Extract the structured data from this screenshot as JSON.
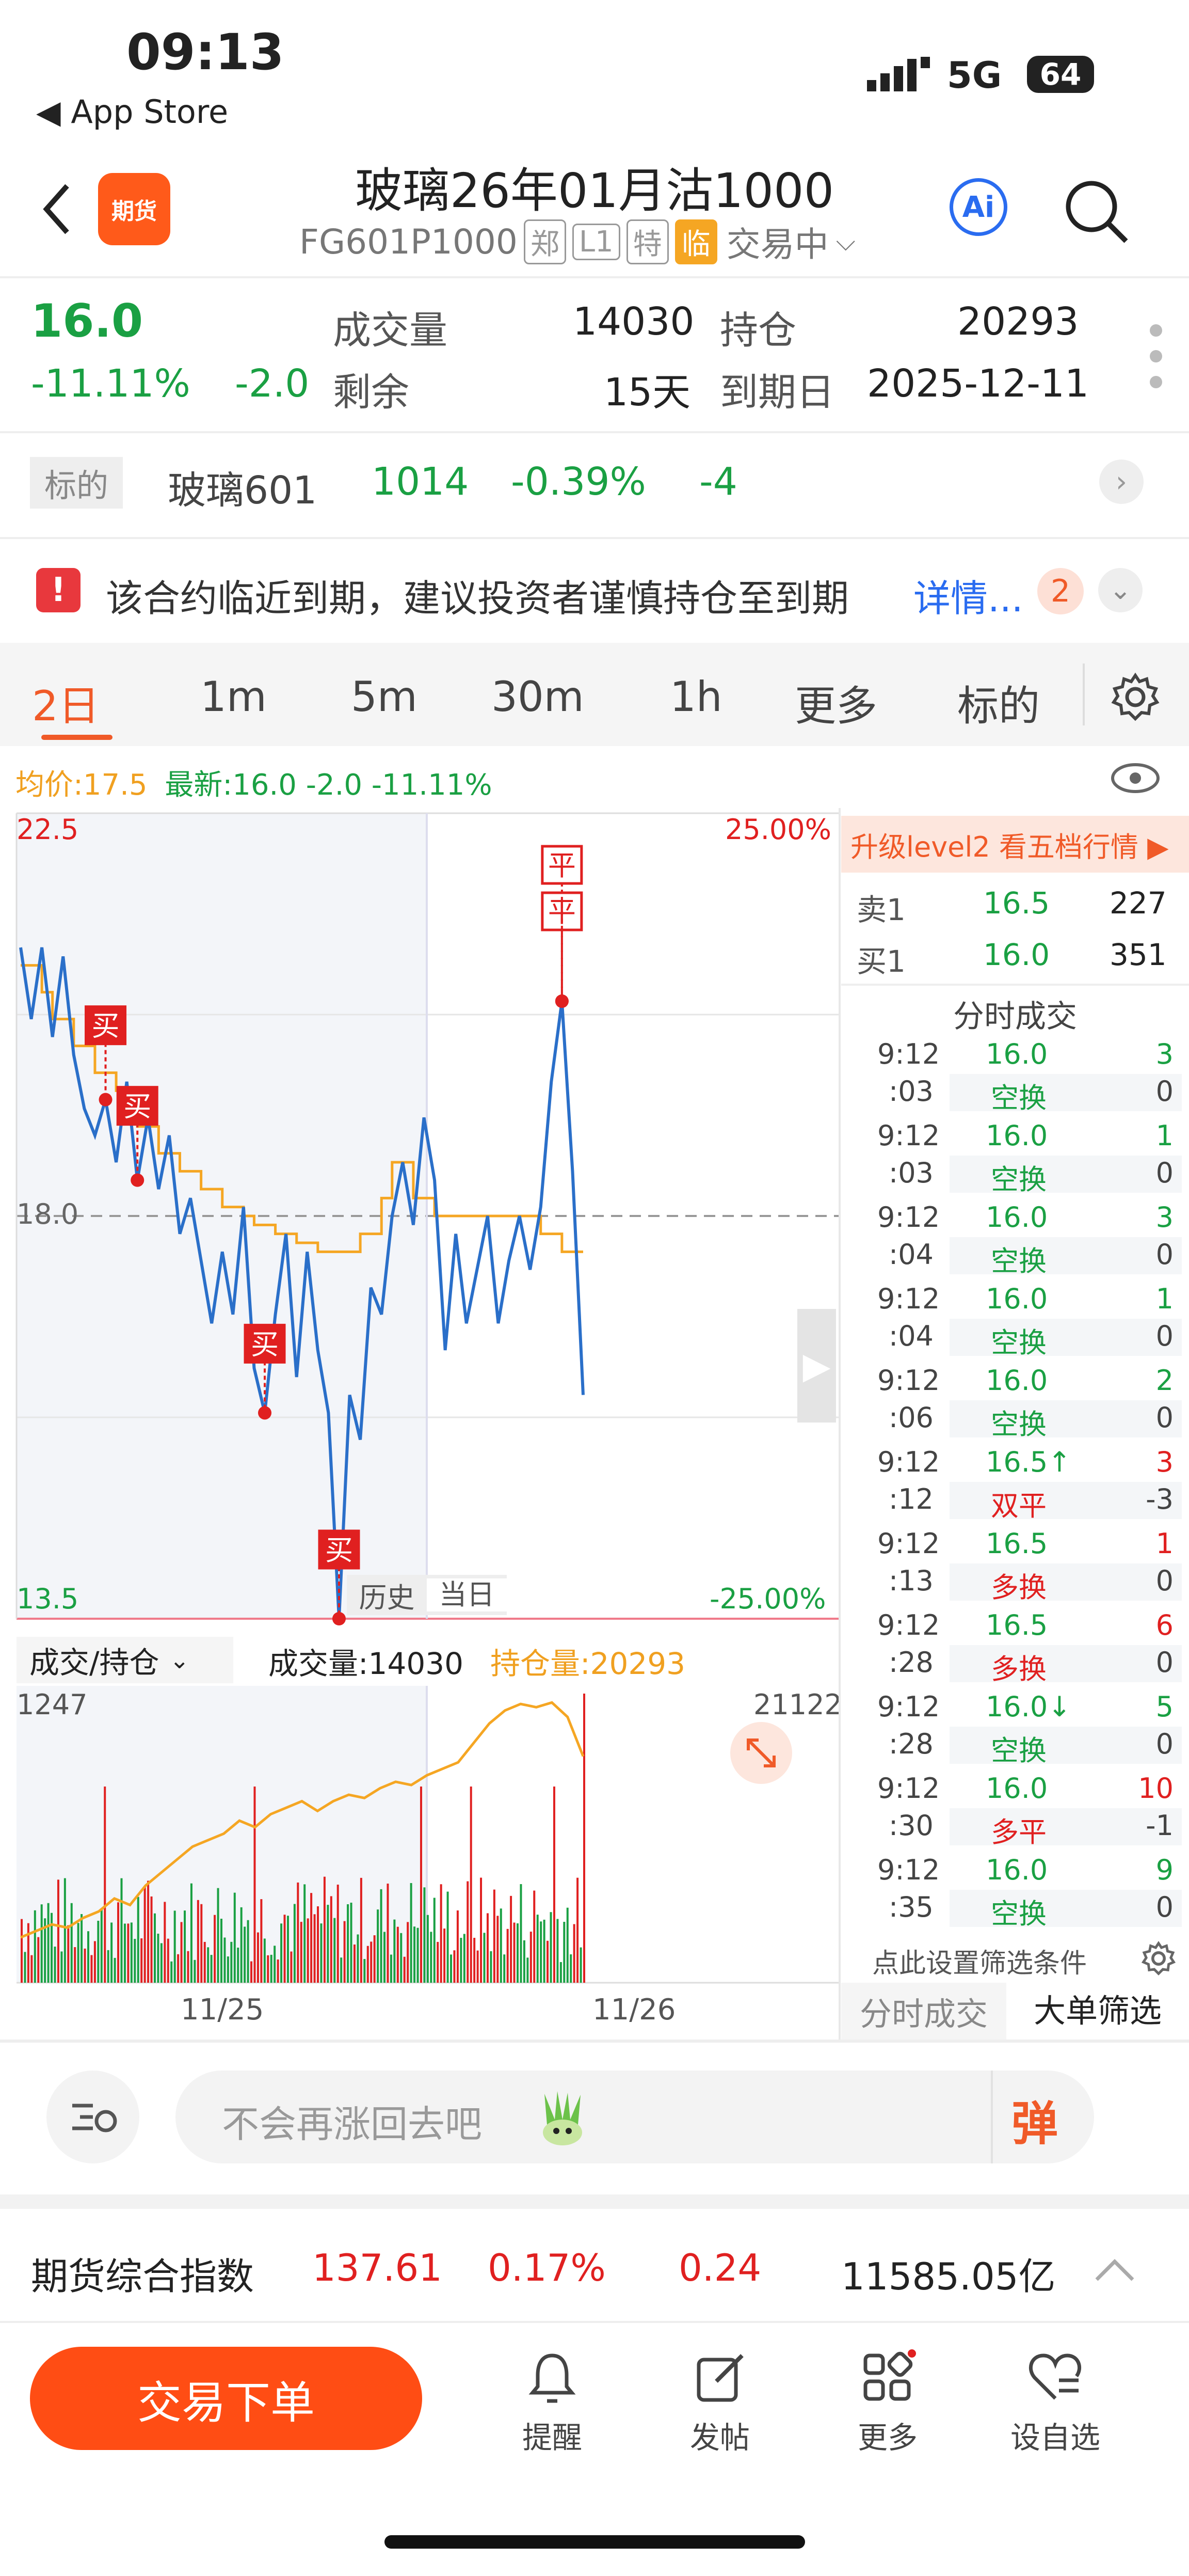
{
  "status": {
    "time": "09:13",
    "back_app": "◀ App Store",
    "network": "5G",
    "battery": "64"
  },
  "header": {
    "logo_text": "期货",
    "title": "玻璃26年01月沽1000",
    "code": "FG601P1000",
    "tags": [
      "郑",
      "L1",
      "特",
      "临"
    ],
    "trade_status": "交易中",
    "ai_label": "Ai"
  },
  "quote": {
    "price": "16.0",
    "change_pct": "-11.11%",
    "change": "-2.0",
    "volume_label": "成交量",
    "volume": "14030",
    "oi_label": "持仓",
    "oi": "20293",
    "remain_label": "剩余",
    "remain": "15天",
    "expiry_label": "到期日",
    "expiry": "2025-12-11"
  },
  "underlying": {
    "tag": "标的",
    "name": "玻璃601",
    "price": "1014",
    "change_pct": "-0.39%",
    "change": "-4"
  },
  "notice": {
    "text": "该合约临近到期，建议投资者谨慎持仓至到期",
    "link": "详情...",
    "count": "2"
  },
  "tabs": {
    "items": [
      "2日",
      "1m",
      "5m",
      "30m",
      "1h",
      "更多",
      "标的"
    ],
    "active": "2日"
  },
  "chart_info": {
    "avg": "均价:17.5",
    "latest": "最新:16.0 -2.0 -11.11%"
  },
  "chart_data": {
    "type": "line",
    "title": "",
    "y_top_label": "22.5",
    "y_mid_label": "18.0",
    "y_bottom_label": "13.5",
    "pct_top_label": "25.00%",
    "pct_bottom_label": "-25.00%",
    "ylim": [
      13.5,
      22.5
    ],
    "x_labels": [
      "11/25",
      "11/26"
    ],
    "history_label": "历史",
    "today_label": "当日",
    "series": [
      {
        "name": "最新",
        "color": "#2a6fc9",
        "values": [
          21.0,
          20.2,
          21.0,
          20.0,
          20.9,
          19.8,
          19.2,
          18.9,
          19.3,
          18.6,
          19.5,
          18.4,
          19.1,
          18.3,
          18.9,
          17.8,
          18.2,
          17.5,
          16.8,
          17.6,
          16.9,
          18.1,
          16.3,
          15.8,
          16.9,
          17.8,
          16.2,
          17.6,
          16.5,
          15.8,
          13.5,
          16.0,
          15.5,
          17.2,
          16.9,
          18.0,
          18.6,
          17.9,
          19.1,
          18.4,
          16.5,
          17.8,
          16.8,
          17.4,
          18.0,
          16.8,
          17.5,
          18.0,
          17.4,
          18.1,
          19.5,
          20.4,
          18.5,
          16.0
        ]
      },
      {
        "name": "均价",
        "color": "#f5a623",
        "values": [
          20.8,
          20.8,
          20.5,
          20.2,
          20.2,
          19.9,
          19.9,
          19.6,
          19.6,
          19.4,
          19.4,
          19.0,
          19.0,
          18.7,
          18.7,
          18.5,
          18.5,
          18.3,
          18.3,
          18.1,
          18.1,
          18.0,
          17.9,
          17.9,
          17.8,
          17.8,
          17.7,
          17.7,
          17.6,
          17.6,
          17.6,
          17.6,
          17.8,
          17.8,
          18.2,
          18.6,
          18.6,
          18.2,
          18.2,
          18.0,
          18.0,
          18.0,
          18.0,
          18.0,
          18.0,
          18.0,
          18.0,
          18.0,
          18.0,
          17.8,
          17.8,
          17.6,
          17.6,
          17.6
        ]
      }
    ],
    "markers": [
      {
        "label": "买",
        "index": 8
      },
      {
        "label": "买",
        "index": 11
      },
      {
        "label": "买",
        "index": 23
      },
      {
        "label": "买",
        "index": 30
      },
      {
        "label": "平",
        "index": 51
      },
      {
        "label": "平",
        "index": 51
      }
    ],
    "sub_chart": {
      "selector": "成交/持仓",
      "volume_label": "成交量:14030",
      "oi_label": "持仓量:20293",
      "left_max": "1247",
      "right_max": "21122",
      "oi_series": [
        17500,
        17600,
        17700,
        17650,
        17800,
        17900,
        18100,
        18000,
        18300,
        18500,
        18700,
        18900,
        19000,
        19100,
        19300,
        19200,
        19400,
        19500,
        19600,
        19450,
        19600,
        19700,
        19650,
        19800,
        19900,
        19850,
        20000,
        20100,
        20200,
        20500,
        20800,
        21000,
        21100,
        21050,
        21122,
        20900,
        20293
      ]
    }
  },
  "right_panel": {
    "upgrade": "升级level2 看五档行情 ▶",
    "ask": {
      "label": "卖1",
      "price": "16.5",
      "qty": "227"
    },
    "bid": {
      "label": "买1",
      "price": "16.0",
      "qty": "351"
    },
    "ticks_title": "分时成交",
    "ticks": [
      {
        "time": "9:12",
        "sec": ":03",
        "price": "16.0",
        "qty": "3",
        "type": "空换",
        "oi": "0",
        "pcolor": "green",
        "qcolor": "green",
        "tcolor": "green"
      },
      {
        "time": "9:12",
        "sec": ":03",
        "price": "16.0",
        "qty": "1",
        "type": "空换",
        "oi": "0",
        "pcolor": "green",
        "qcolor": "green",
        "tcolor": "green"
      },
      {
        "time": "9:12",
        "sec": ":04",
        "price": "16.0",
        "qty": "3",
        "type": "空换",
        "oi": "0",
        "pcolor": "green",
        "qcolor": "green",
        "tcolor": "green"
      },
      {
        "time": "9:12",
        "sec": ":04",
        "price": "16.0",
        "qty": "1",
        "type": "空换",
        "oi": "0",
        "pcolor": "green",
        "qcolor": "green",
        "tcolor": "green"
      },
      {
        "time": "9:12",
        "sec": ":06",
        "price": "16.0",
        "qty": "2",
        "type": "空换",
        "oi": "0",
        "pcolor": "green",
        "qcolor": "green",
        "tcolor": "green"
      },
      {
        "time": "9:12",
        "sec": ":12",
        "price": "16.5↑",
        "qty": "3",
        "type": "双平",
        "oi": "-3",
        "pcolor": "green",
        "qcolor": "red",
        "tcolor": "red"
      },
      {
        "time": "9:12",
        "sec": ":13",
        "price": "16.5",
        "qty": "1",
        "type": "多换",
        "oi": "0",
        "pcolor": "green",
        "qcolor": "red",
        "tcolor": "red"
      },
      {
        "time": "9:12",
        "sec": ":28",
        "price": "16.5",
        "qty": "6",
        "type": "多换",
        "oi": "0",
        "pcolor": "green",
        "qcolor": "red",
        "tcolor": "red"
      },
      {
        "time": "9:12",
        "sec": ":28",
        "price": "16.0↓",
        "qty": "5",
        "type": "空换",
        "oi": "0",
        "pcolor": "green",
        "qcolor": "green",
        "tcolor": "green"
      },
      {
        "time": "9:12",
        "sec": ":30",
        "price": "16.0",
        "qty": "10",
        "type": "多平",
        "oi": "-1",
        "pcolor": "green",
        "qcolor": "red",
        "tcolor": "red"
      },
      {
        "time": "9:12",
        "sec": ":35",
        "price": "16.0",
        "qty": "9",
        "type": "空换",
        "oi": "0",
        "pcolor": "green",
        "qcolor": "green",
        "tcolor": "green"
      }
    ],
    "filter_hint": "点此设置筛选条件",
    "tab_ticks": "分时成交",
    "tab_large": "大单筛选"
  },
  "input": {
    "placeholder": "不会再涨回去吧",
    "send": "弹"
  },
  "index": {
    "name": "期货综合指数",
    "value": "137.61",
    "pct": "0.17%",
    "change": "0.24",
    "amount": "11585.05亿"
  },
  "nav": {
    "order": "交易下单",
    "remind": "提醒",
    "post": "发帖",
    "more": "更多",
    "watch": "设自选"
  },
  "colors": {
    "up": "#e02020",
    "down": "#1aa043",
    "accent": "#ff4d14",
    "price_line": "#2a6fc9",
    "avg_line": "#f5a623"
  }
}
